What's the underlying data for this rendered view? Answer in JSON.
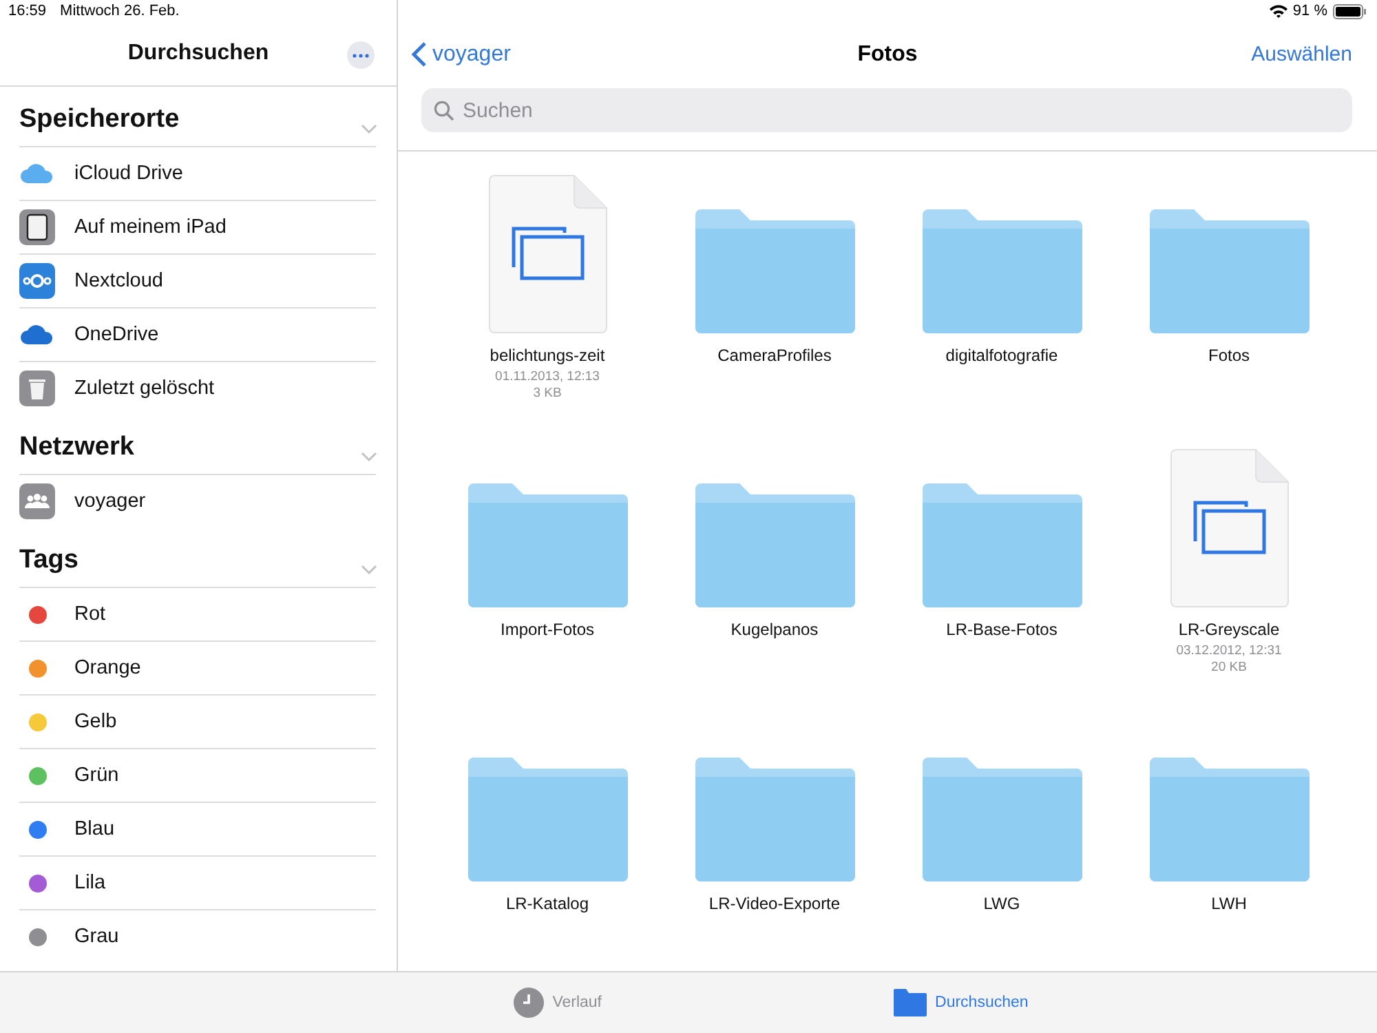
{
  "status_bar": {
    "time": "16:59",
    "date": "Mittwoch 26. Feb.",
    "battery": "91 %"
  },
  "sidebar": {
    "title": "Durchsuchen",
    "sections": [
      {
        "title": "Speicherorte",
        "expanded": true,
        "items": [
          {
            "kind": "icloud",
            "label": "iCloud Drive"
          },
          {
            "kind": "ipad",
            "label": "Auf meinem iPad"
          },
          {
            "kind": "nextcloud",
            "label": "Nextcloud"
          },
          {
            "kind": "onedrive",
            "label": "OneDrive"
          },
          {
            "kind": "trash",
            "label": "Zuletzt gelöscht"
          }
        ]
      },
      {
        "title": "Netzwerk",
        "expanded": true,
        "items": [
          {
            "kind": "server",
            "label": "voyager"
          }
        ]
      },
      {
        "title": "Tags",
        "expanded": true,
        "items": [
          {
            "kind": "tag",
            "label": "Rot",
            "color": "#e5473e"
          },
          {
            "kind": "tag",
            "label": "Orange",
            "color": "#f2922e"
          },
          {
            "kind": "tag",
            "label": "Gelb",
            "color": "#f5c93a"
          },
          {
            "kind": "tag",
            "label": "Grün",
            "color": "#5cc15e"
          },
          {
            "kind": "tag",
            "label": "Blau",
            "color": "#2f7df0"
          },
          {
            "kind": "tag",
            "label": "Lila",
            "color": "#a35bd6"
          },
          {
            "kind": "tag",
            "label": "Grau",
            "color": "#8e8e93"
          }
        ]
      }
    ]
  },
  "nav": {
    "back": "voyager",
    "title": "Fotos",
    "action": "Auswählen"
  },
  "search": {
    "placeholder": "Suchen"
  },
  "files": [
    {
      "kind": "document",
      "name": "belichtungs-zeit",
      "date": "01.11.2013, 12:13",
      "size": "3 KB"
    },
    {
      "kind": "folder",
      "name": "CameraProfiles"
    },
    {
      "kind": "folder",
      "name": "digitalfotografie"
    },
    {
      "kind": "folder",
      "name": "Fotos"
    },
    {
      "kind": "folder",
      "name": "Import-Fotos"
    },
    {
      "kind": "folder",
      "name": "Kugelpanos"
    },
    {
      "kind": "folder",
      "name": "LR-Base-Fotos"
    },
    {
      "kind": "document",
      "name": "LR-Greyscale",
      "date": "03.12.2012, 12:31",
      "size": "20 KB"
    },
    {
      "kind": "folder",
      "name": "LR-Katalog"
    },
    {
      "kind": "folder",
      "name": "LR-Video-Exporte"
    },
    {
      "kind": "folder",
      "name": "LWG"
    },
    {
      "kind": "folder",
      "name": "LWH"
    }
  ],
  "tab_bar": [
    {
      "kind": "recents",
      "label": "Verlauf",
      "selected": false
    },
    {
      "kind": "browse",
      "label": "Durchsuchen",
      "selected": true
    }
  ]
}
